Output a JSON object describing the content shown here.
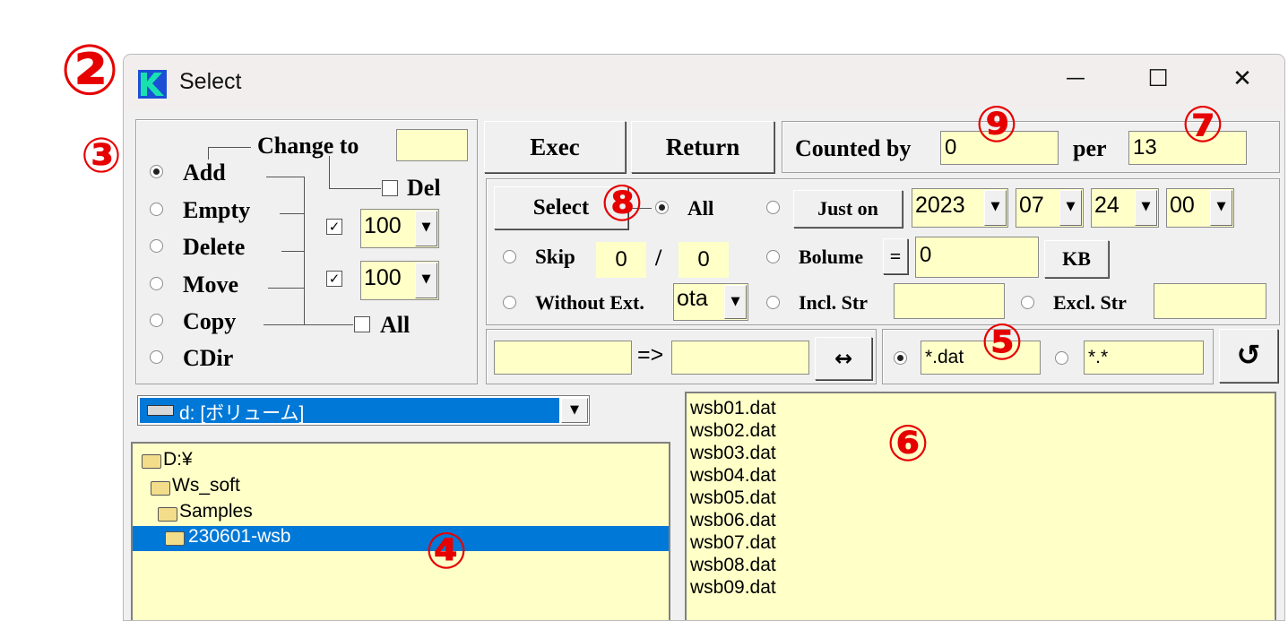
{
  "window": {
    "title": "Select",
    "minimize": "—",
    "maximize": "☐",
    "close": "✕"
  },
  "annotations": [
    "②",
    "③",
    "⑨",
    "⑦",
    "⑧",
    "⑤",
    "⑥",
    "④"
  ],
  "op_panel": {
    "change_to_label": "Change to",
    "change_to_value": "",
    "del_label": "Del",
    "all_label": "All",
    "operations": [
      "Add",
      "Empty",
      "Delete",
      "Move",
      "Copy",
      "CDir"
    ],
    "selected_operation": "Add",
    "combo1": "100",
    "combo2": "100",
    "check1_checked": true,
    "check2_checked": true,
    "del_checked": false,
    "all_checked": false
  },
  "buttons": {
    "exec": "Exec",
    "return": "Return",
    "select": "Select",
    "just_on": "Just on",
    "eq": "=",
    "kb": "KB",
    "swap": "↔",
    "refresh": "↺"
  },
  "counted": {
    "label": "Counted by",
    "value": "0",
    "per_label": "per",
    "per_value": "13"
  },
  "select_panel": {
    "all_label": "All",
    "skip_label": "Skip",
    "skip_a": "0",
    "skip_sep": "/",
    "skip_b": "0",
    "without_ext_label": "Without Ext.",
    "ext_value": "ota",
    "date": {
      "year": "2023",
      "month": "07",
      "day": "24",
      "hour": "00"
    },
    "bolume_label": "Bolume",
    "size_value": "0",
    "incl_label": "Incl. Str",
    "incl_value": "",
    "excl_label": "Excl. Str",
    "excl_value": ""
  },
  "rename": {
    "from": "",
    "arrow": "=>",
    "to": ""
  },
  "pattern": {
    "p1": "*.dat",
    "p2": "*.*"
  },
  "drive": {
    "label": "d: [ボリューム]"
  },
  "tree": [
    {
      "label": "D:¥"
    },
    {
      "label": "Ws_soft"
    },
    {
      "label": "Samples"
    },
    {
      "label": "230601-wsb"
    }
  ],
  "files": [
    "wsb01.dat",
    "wsb02.dat",
    "wsb03.dat",
    "wsb04.dat",
    "wsb05.dat",
    "wsb06.dat",
    "wsb07.dat",
    "wsb08.dat",
    "wsb09.dat"
  ],
  "colors": {
    "field_bg": "#ffffc8",
    "selection": "#0078d7",
    "annotation": "#e60000"
  }
}
